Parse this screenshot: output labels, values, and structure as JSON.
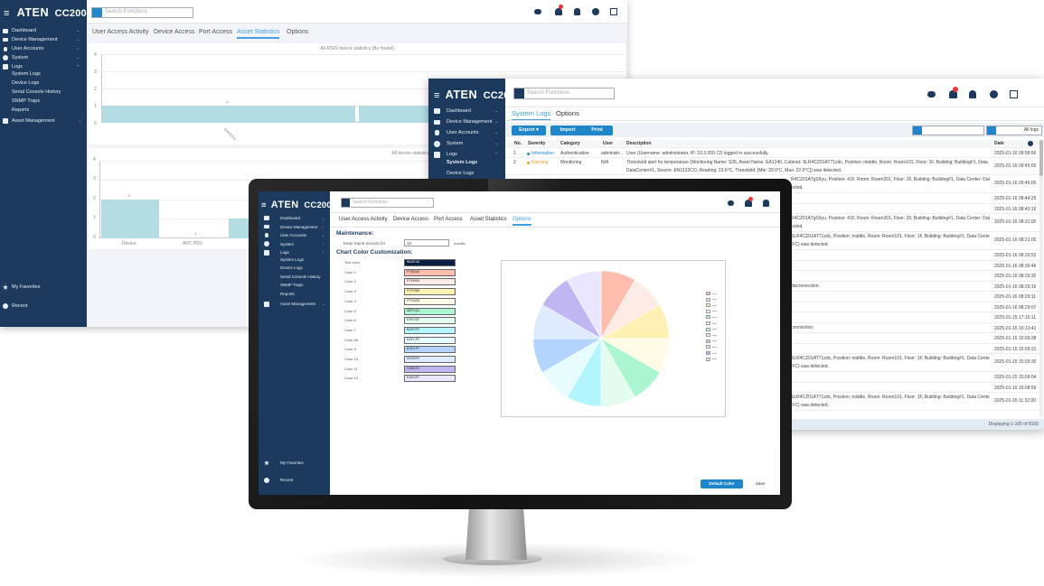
{
  "brand": {
    "logo": "ATEN",
    "product": "CC2000"
  },
  "header": {
    "search_placeholder": "Search Functions",
    "badge_count": "5"
  },
  "sidebar": {
    "items": [
      {
        "label": "Dashboard",
        "icon": "grid-icon",
        "chevron": "⌄"
      },
      {
        "label": "Device Management",
        "icon": "device-icon",
        "chevron": "⌄"
      },
      {
        "label": "User Accounts",
        "icon": "user-icon",
        "chevron": "⌄"
      },
      {
        "label": "System",
        "icon": "gear-icon",
        "chevron": "⌄"
      },
      {
        "label": "Logs",
        "icon": "log-icon",
        "chevron": "⌃"
      }
    ],
    "log_subitems": [
      "System Logs",
      "Device Logs",
      "Serial Console History",
      "SNMP Traps",
      "Reports"
    ],
    "asset": {
      "label": "Asset Management",
      "chevron": "⌄"
    },
    "favorites": "My Favorites",
    "recent": "Recent"
  },
  "back": {
    "tabs": [
      "User Access Activity",
      "Device Access",
      "Port Access",
      "Asset Statistics",
      "Options"
    ],
    "active_tab": "Asset Statistics",
    "chart1": {
      "title": "All ATEN device statistics (By model)",
      "yticks": [
        "0",
        "1",
        "2",
        "3",
        "4"
      ],
      "value_label": "1",
      "rotated_label": "EN0320A"
    },
    "chart2": {
      "title": "All device statistics (By category)",
      "yticks": [
        "0",
        "1",
        "2",
        "3",
        "4"
      ],
      "value_labels": [
        "2",
        "1"
      ],
      "categories": [
        "Device",
        "APC PDU"
      ]
    }
  },
  "mid": {
    "tabs": [
      "System Logs",
      "Options"
    ],
    "active_tab": "System Logs",
    "buttons": {
      "export": "Export",
      "import": "Import",
      "print": "Print"
    },
    "filter_label": "All logs",
    "columns": [
      "No.",
      "Severity",
      "Category",
      "User",
      "Description",
      "Date"
    ],
    "rows": [
      {
        "no": "1",
        "severity": "Information",
        "sev_color": "#1e86c9",
        "category": "Authentication",
        "user": "administr...",
        "desc": "User (Username: administrator, IP: 10.3.209.72) logged in successfully.",
        "date": "2025-01-16 09:58:56"
      },
      {
        "no": "2",
        "severity": "Warning",
        "sev_color": "#f0a020",
        "category": "Monitoring",
        "user": "N/A",
        "desc": "Threshold alert for temperature (Monitoring Name: S36, Asset Name: EA1240, Cabinet: SLR4CZ01AT71zdc, Position: middle, Room: Room101, Floor: 1F, Building: Building#1, Data Center:",
        "desc2": "DataCenter#1, Source: EN1132CO, Reading: 23.6°C, Threshold: [Min: 20.0°C, Max: 22.0°C]) was detected.",
        "date": "2025-01-16 09:45:00"
      }
    ],
    "right_texts": [
      {
        "desc": "R4CZ01ATgS6yu, Position: 41F, Room: Room201, Floor: 2F, Building: Building#1, Data Center: Data",
        "desc2": "ected.",
        "date": "2025-01-16 09:45:00"
      },
      {
        "desc": "",
        "date": "2025-01-16 08:44:29"
      },
      {
        "desc": "",
        "date": "2025-01-16 08:43:16"
      },
      {
        "desc": "R4CZ01ATgS6yu, Position: 41F, Room: Room201, Floor: 2F, Building: Building#1, Data Center: Data",
        "desc2": "ected.",
        "date": "2025-01-16 08:31:00"
      },
      {
        "desc": "SLR4CZ01AT71zdc, Position: middle, Room: Room101, Floor: 1F, Building: Building#1, Data Center:",
        "desc2": "IFC) was detected.",
        "date": "2025-01-16 08:31:00"
      },
      {
        "desc": "",
        "date": "2025-01-16 08:30:52"
      },
      {
        "desc": "",
        "date": "2025-01-16 08:30:46"
      },
      {
        "desc": "",
        "date": "2025-01-16 08:29:30"
      },
      {
        "desc": "disconnection.",
        "date": "2025-01-16 08:29:16"
      },
      {
        "desc": "",
        "date": "2025-01-16 08:29:11"
      },
      {
        "desc": "",
        "date": "2025-01-16 08:29:07"
      },
      {
        "desc": "",
        "date": "2025-01-15 17:15:11"
      },
      {
        "desc": "connection.",
        "date": "2025-01-15 16:13:41"
      },
      {
        "desc": "",
        "date": "2025-01-15 15:09:38"
      },
      {
        "desc": "",
        "date": "2025-01-15 15:09:31"
      },
      {
        "desc": "SLR4CZ01AT71zdc, Position: middle, Room: Room101, Floor: 1F, Building: Building#1, Data Center:",
        "desc2": "IFC) was detected.",
        "date": "2025-01-15 15:09:30"
      },
      {
        "desc": "",
        "date": "2025-01-15 15:09:04"
      },
      {
        "desc": "",
        "date": "2025-01-15 15:08:59"
      },
      {
        "desc": "SLR4CZ01AT71zdc, Position: middle, Room: Room101, Floor: 1F, Building: Building#1, Data Center:",
        "desc2": "IFC) was detected.",
        "date": "2025-01-15 11:32:00"
      }
    ],
    "footer": "Displaying 1-100 of 8100"
  },
  "front": {
    "tabs": [
      "User Access Activity",
      "Device Access",
      "Port Access",
      "Asset Statistics",
      "Options"
    ],
    "active_tab": "Options",
    "maintenance_heading": "Maintenance:",
    "keep_label": "Keep report records for",
    "keep_value": "12",
    "keep_unit": "months",
    "chart_heading": "Chart Color Customization:",
    "colors": [
      {
        "label": "Text color",
        "value": "091E42",
        "hex": "#091E42"
      },
      {
        "label": "Color 1",
        "value": "FFBDAD",
        "hex": "#FFBDAD"
      },
      {
        "label": "Color 2",
        "value": "FFEBE6",
        "hex": "#FFEBE6"
      },
      {
        "label": "Color 3",
        "value": "FFF0B3",
        "hex": "#FFF0B3"
      },
      {
        "label": "Color 4",
        "value": "FFFAE6",
        "hex": "#FFFAE6"
      },
      {
        "label": "Color 5",
        "value": "ABF5D1",
        "hex": "#ABF5D1"
      },
      {
        "label": "Color 6",
        "value": "E3FCEF",
        "hex": "#E3FCEF"
      },
      {
        "label": "Color 7",
        "value": "B3F5FF",
        "hex": "#B3F5FF"
      },
      {
        "label": "Color 8d",
        "value": "E6FCFF",
        "hex": "#E6FCFF"
      },
      {
        "label": "Color 9",
        "value": "B3D4FF",
        "hex": "#B3D4FF"
      },
      {
        "label": "Color 10",
        "value": "DEEBFF",
        "hex": "#DEEBFF"
      },
      {
        "label": "Color 11",
        "value": "C0B6F2",
        "hex": "#C0B6F2"
      },
      {
        "label": "Color 12",
        "value": "EAE6FF",
        "hex": "#EAE6FF"
      }
    ],
    "buttons": {
      "default_color": "Default Color",
      "save": "Save"
    }
  }
}
